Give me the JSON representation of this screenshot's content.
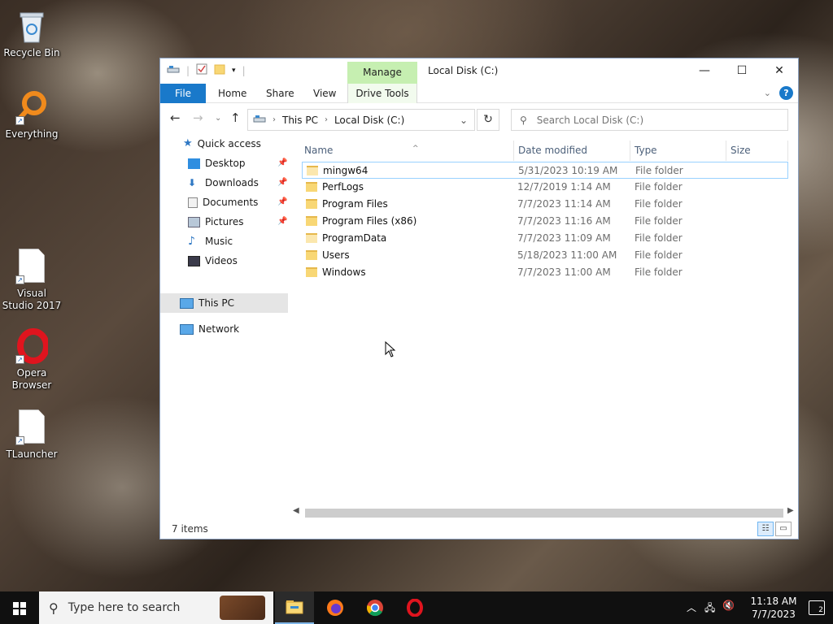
{
  "desktop": {
    "icons": [
      {
        "label": "Recycle Bin",
        "icon": "recycle-bin-icon"
      },
      {
        "label": "Everything",
        "icon": "everything-search-icon"
      },
      {
        "label": "Visual Studio 2017",
        "icon": "file-icon"
      },
      {
        "label": "Opera Browser",
        "icon": "opera-icon"
      },
      {
        "label": "TLauncher",
        "icon": "file-icon"
      }
    ]
  },
  "window": {
    "title": "Local Disk (C:)",
    "context_tab": "Manage",
    "controls": {
      "minimize": "—",
      "maximize": "☐",
      "close": "✕"
    }
  },
  "ribbon": {
    "tabs": [
      "File",
      "Home",
      "Share",
      "View",
      "Drive Tools"
    ]
  },
  "address": {
    "crumbs": [
      "This PC",
      "Local Disk (C:)"
    ],
    "search_placeholder": "Search Local Disk (C:)"
  },
  "nav_pane": {
    "quick_access": "Quick access",
    "quick_items": [
      {
        "label": "Desktop",
        "pinned": true
      },
      {
        "label": "Downloads",
        "pinned": true
      },
      {
        "label": "Documents",
        "pinned": true
      },
      {
        "label": "Pictures",
        "pinned": true
      },
      {
        "label": "Music",
        "pinned": false
      },
      {
        "label": "Videos",
        "pinned": false
      }
    ],
    "this_pc": "This PC",
    "network": "Network"
  },
  "file_list": {
    "columns": [
      "Name",
      "Date modified",
      "Type",
      "Size"
    ],
    "rows": [
      {
        "name": "mingw64",
        "date": "5/31/2023 10:19 AM",
        "type": "File folder"
      },
      {
        "name": "PerfLogs",
        "date": "12/7/2019 1:14 AM",
        "type": "File folder"
      },
      {
        "name": "Program Files",
        "date": "7/7/2023 11:14 AM",
        "type": "File folder"
      },
      {
        "name": "Program Files (x86)",
        "date": "7/7/2023 11:16 AM",
        "type": "File folder"
      },
      {
        "name": "ProgramData",
        "date": "7/7/2023 11:09 AM",
        "type": "File folder"
      },
      {
        "name": "Users",
        "date": "5/18/2023 11:00 AM",
        "type": "File folder"
      },
      {
        "name": "Windows",
        "date": "7/7/2023 11:00 AM",
        "type": "File folder"
      }
    ]
  },
  "status_bar": {
    "items_count": "7 items"
  },
  "taskbar": {
    "search_placeholder": "Type here to search",
    "apps": [
      "file-explorer-icon",
      "firefox-icon",
      "chrome-icon",
      "opera-icon"
    ],
    "clock_time": "11:18 AM",
    "clock_date": "7/7/2023",
    "notification_count": "2"
  },
  "colors": {
    "accent": "#1979ca",
    "context_tab": "#c6efb1",
    "folder": "#f8d775",
    "taskbar": "#101010"
  }
}
